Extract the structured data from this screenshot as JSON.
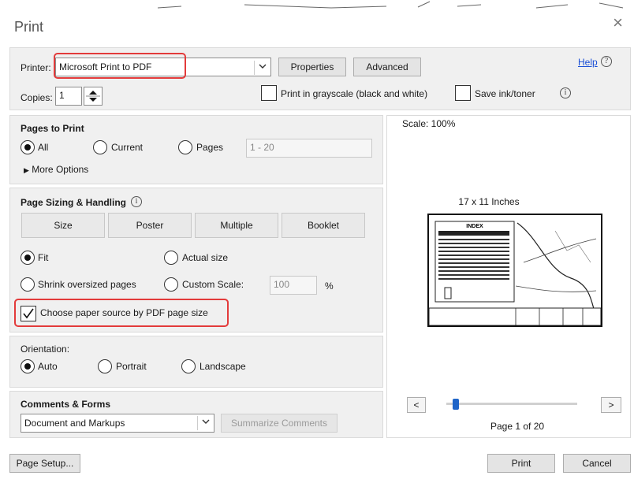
{
  "window": {
    "title": "Print",
    "close_glyph": "×"
  },
  "printer": {
    "label": "Printer:",
    "value": "Microsoft Print to PDF",
    "properties_label": "Properties",
    "advanced_label": "Advanced",
    "help_label": "Help",
    "help_icon": "?"
  },
  "copies": {
    "label": "Copies:",
    "value": "1",
    "grayscale_label": "Print in grayscale (black and white)",
    "saveink_label": "Save ink/toner",
    "info_icon": "i"
  },
  "pages_to_print": {
    "header": "Pages to Print",
    "all_label": "All",
    "current_label": "Current",
    "pages_label": "Pages",
    "pages_value": "1 - 20",
    "more_options_label": "More Options",
    "selected": "All"
  },
  "sizing": {
    "header": "Page Sizing & Handling",
    "info_icon": "i",
    "tabs": [
      "Size",
      "Poster",
      "Multiple",
      "Booklet"
    ],
    "fit_label": "Fit",
    "actual_size_label": "Actual size",
    "shrink_label": "Shrink oversized pages",
    "custom_scale_label": "Custom Scale:",
    "custom_scale_value": "100",
    "percent": "%",
    "choose_paper_label": "Choose paper source by PDF page size",
    "choose_paper_checked": true,
    "selected": "Fit"
  },
  "orientation": {
    "header": "Orientation:",
    "auto_label": "Auto",
    "portrait_label": "Portrait",
    "landscape_label": "Landscape",
    "selected": "Auto"
  },
  "comments": {
    "header": "Comments & Forms",
    "value": "Document and Markups",
    "summarize_label": "Summarize Comments"
  },
  "preview": {
    "scale_label": "Scale: 100%",
    "paper_label": "17 x 11 Inches",
    "thumb_title": "INDEX",
    "prev_glyph": "<",
    "next_glyph": ">",
    "page_label": "Page 1 of 20",
    "page_position": 0.05
  },
  "footer": {
    "page_setup_label": "Page Setup...",
    "print_label": "Print",
    "cancel_label": "Cancel"
  },
  "colors": {
    "highlight": "#e33b3b",
    "slider_thumb": "#1e64c8",
    "link": "#1a4fd6"
  }
}
